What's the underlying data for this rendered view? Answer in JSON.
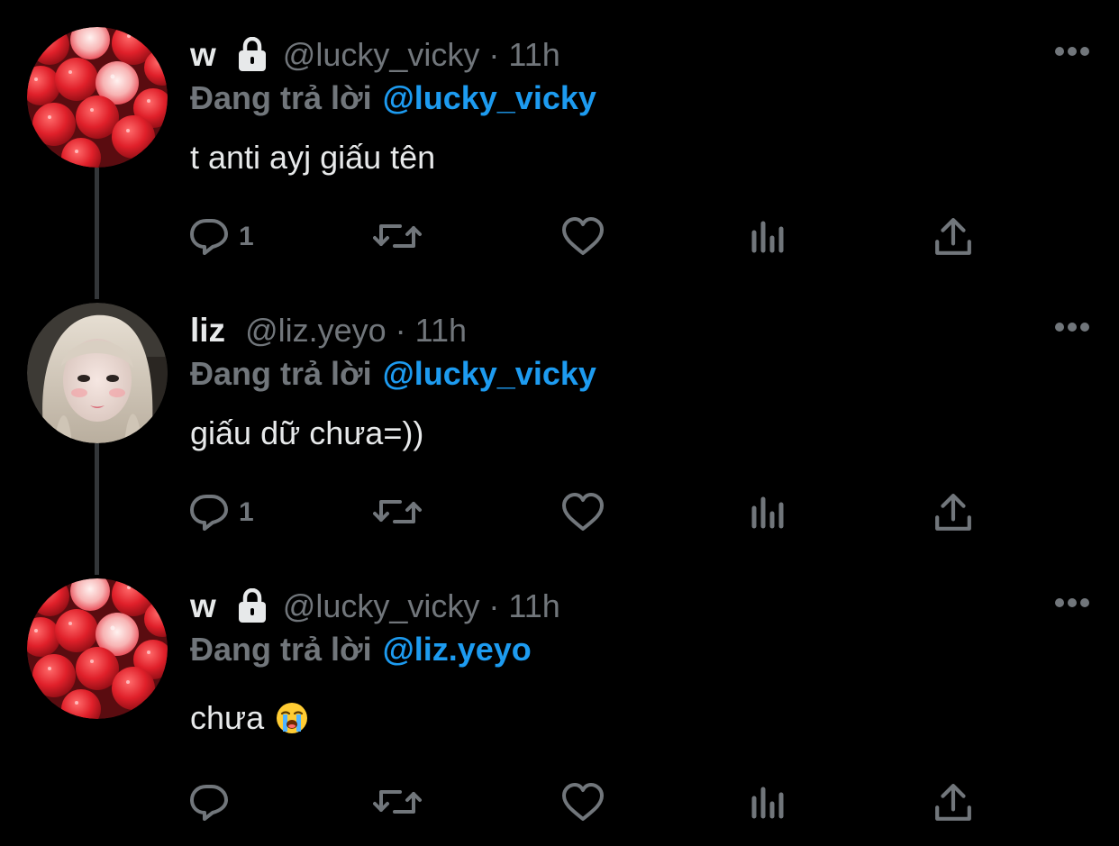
{
  "thread": {
    "tweets": [
      {
        "display_name": "w",
        "locked": true,
        "handle": "@lucky_vicky",
        "separator": "·",
        "time": "11h",
        "replying_prefix": "Đang trả lời",
        "replying_to": "@lucky_vicky",
        "text": "t anti ayj giấu tên",
        "reply_count": "1",
        "avatar": "strawberry-avatar"
      },
      {
        "display_name": "liz",
        "locked": false,
        "handle": "@liz.yeyo",
        "separator": "·",
        "time": "11h",
        "replying_prefix": "Đang trả lời",
        "replying_to": "@lucky_vicky",
        "text": "giấu dữ chưa=))",
        "reply_count": "1",
        "avatar": "portrait-avatar"
      },
      {
        "display_name": "w",
        "locked": true,
        "handle": "@lucky_vicky",
        "separator": "·",
        "time": "11h",
        "replying_prefix": "Đang trả lời",
        "replying_to": "@liz.yeyo",
        "text": "chưa",
        "text_emoji": "loudly-crying-face-emoji",
        "reply_count": "",
        "avatar": "strawberry-avatar"
      }
    ]
  },
  "colors": {
    "background": "#000000",
    "text_primary": "#e7e9ea",
    "text_secondary": "#71767b",
    "accent": "#1d9bf0",
    "thread_line": "#333639"
  },
  "icons": {
    "reply": "reply-icon",
    "retweet": "retweet-icon",
    "like": "heart-icon",
    "views": "views-icon",
    "share": "share-icon",
    "more": "more-icon",
    "lock": "lock-icon"
  }
}
